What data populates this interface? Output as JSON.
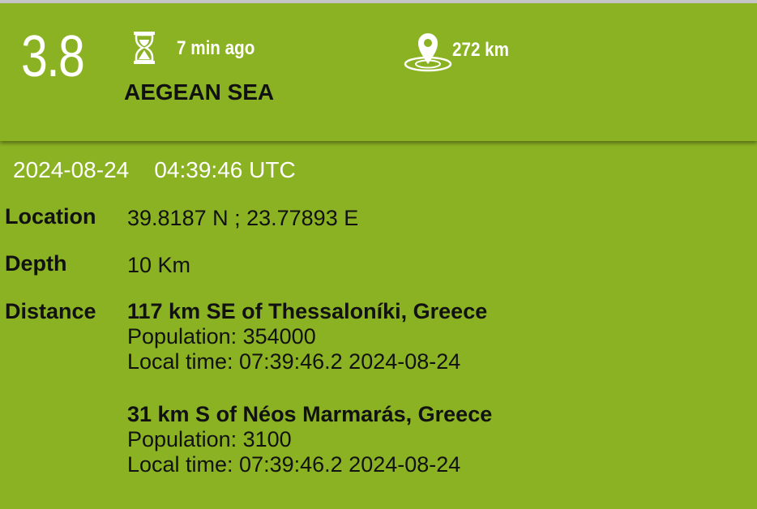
{
  "event": {
    "magnitude": "3.8",
    "time_ago": "7 min ago",
    "region": "AEGEAN SEA",
    "distance": "272 km",
    "datetime": "2024-08-24    04:39:46 UTC"
  },
  "details": {
    "location_label": "Location",
    "location_value": "39.8187 N ; 23.77893 E",
    "depth_label": "Depth",
    "depth_value": "10 Km",
    "distance_label": "Distance",
    "nearby": [
      {
        "city": "117 km SE of Thessaloníki, Greece",
        "population": "Population: 354000",
        "local_time": "Local time: 07:39:46.2 2024-08-24"
      },
      {
        "city": "31 km S of Néos Marmarás, Greece",
        "population": "Population: 3100",
        "local_time": "Local time: 07:39:46.2 2024-08-24"
      }
    ]
  },
  "icons": {
    "time": "hourglass-icon",
    "distance": "map-pin-icon"
  },
  "colors": {
    "background": "#8ab223",
    "header_text": "#ffffff",
    "body_text": "#111111",
    "top_bar": "#c6c6c6"
  }
}
